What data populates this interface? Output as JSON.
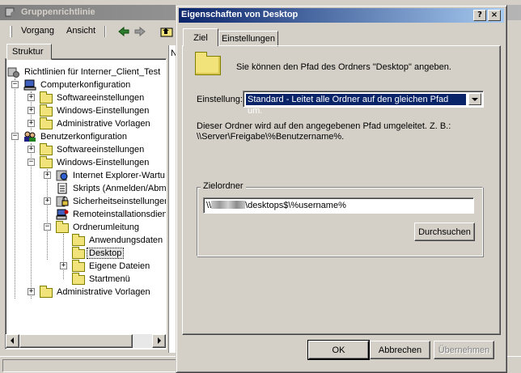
{
  "background_window": {
    "title": "Gruppenrichtlinie",
    "menu": {
      "vorgang": "Vorgang",
      "ansicht": "Ansicht"
    },
    "tab_struktur": "Struktur",
    "right_column_header": "N",
    "tree": {
      "root": "Richtlinien für Interner_Client_Test",
      "computerkonfiguration": "Computerkonfiguration",
      "ck_softwareeinstellungen": "Softwareeinstellungen",
      "ck_windows_einstellungen": "Windows-Einstellungen",
      "ck_administrative_vorlagen": "Administrative Vorlagen",
      "benutzerkonfiguration": "Benutzerkonfiguration",
      "bk_softwareeinstellungen": "Softwareeinstellungen",
      "bk_windows_einstellungen": "Windows-Einstellungen",
      "internet_explorer": "Internet Explorer-Wartu",
      "skripts": "Skripts (Anmelden/Abme",
      "sicherheit": "Sicherheitseinstellunger",
      "remoteinstallation": "Remoteinstallationsdien",
      "ordnerumleitung": "Ordnerumleitung",
      "anwendungsdaten": "Anwendungsdaten",
      "desktop": "Desktop",
      "eigene_dateien": "Eigene Dateien",
      "startmenu": "Startmenü",
      "bk_administrative_vorlagen": "Administrative Vorlagen"
    }
  },
  "dialog": {
    "title": "Eigenschaften von Desktop",
    "help_button": "?",
    "close_button": "×",
    "tabs": {
      "ziel": "Ziel",
      "einstellungen": "Einstellungen"
    },
    "description": "Sie können den Pfad des Ordners \"Desktop\" angeben.",
    "einstellung_label": "Einstellung:",
    "einstellung_value": "Standard - Leitet alle Ordner auf den gleichen Pfad um.",
    "info_line1": "Dieser Ordner wird auf den angegebenen Pfad umgeleitet. Z. B.:",
    "info_line2": "\\\\Server\\Freigabe\\%Benutzername%.",
    "zielordner_label": "Zielordner",
    "zielordner_prefix": "\\\\",
    "zielordner_suffix": "\\desktops$\\%username%",
    "durchsuchen": "Durchsuchen",
    "ok": "OK",
    "abbrechen": "Abbrechen",
    "uebernehmen": "Übernehmen"
  }
}
